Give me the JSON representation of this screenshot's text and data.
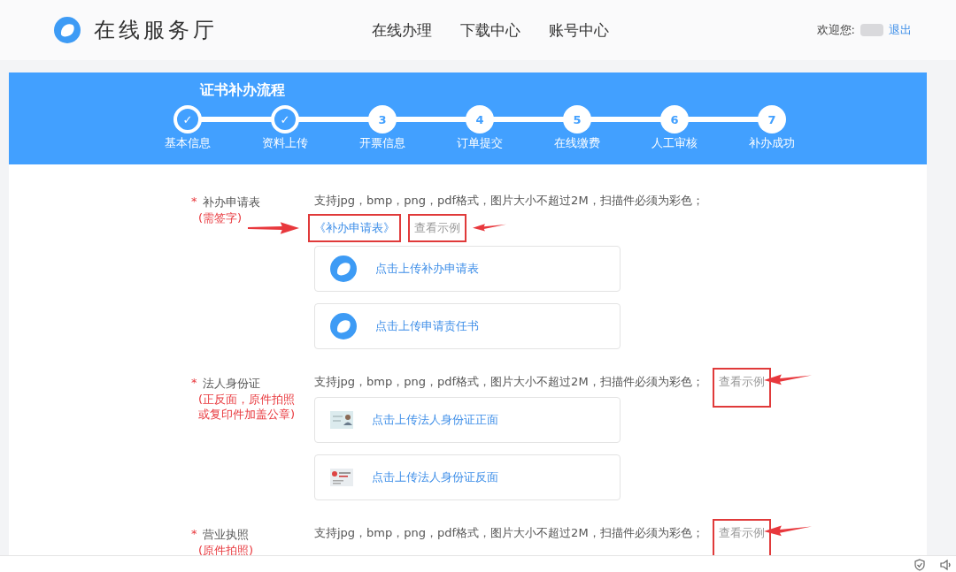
{
  "header": {
    "site_title": "在线服务厅",
    "nav": [
      {
        "label": "在线办理"
      },
      {
        "label": "下载中心"
      },
      {
        "label": "账号中心"
      }
    ],
    "welcome": "欢迎您:",
    "logout": "退出"
  },
  "process": {
    "title": "证书补办流程",
    "steps": [
      {
        "label": "基本信息",
        "done": true
      },
      {
        "label": "资料上传",
        "done": true
      },
      {
        "number": "3",
        "label": "开票信息",
        "done": false
      },
      {
        "number": "4",
        "label": "订单提交",
        "done": false
      },
      {
        "number": "5",
        "label": "在线缴费",
        "done": false
      },
      {
        "number": "6",
        "label": "人工审核",
        "done": false
      },
      {
        "number": "7",
        "label": "补办成功",
        "done": false
      }
    ],
    "check": "✓"
  },
  "sections": [
    {
      "required": "*",
      "label": "补办申请表",
      "note": "(需签字)",
      "hint": "支持jpg，bmp，png，pdf格式，图片大小不超过2M，扫描件必须为彩色；",
      "form_link": {
        "text": "《补办申请表》",
        "marked": true
      },
      "example": {
        "text": "查看示例",
        "marked": true
      },
      "arrow_left": true,
      "arrow_right": true,
      "uploads": [
        {
          "text": "点击上传补办申请表",
          "kind": "logo"
        },
        {
          "text": "点击上传申请责任书",
          "kind": "logo"
        }
      ]
    },
    {
      "required": "*",
      "label": "法人身份证",
      "note": "(正反面，原件拍照或复印件加盖公章)",
      "hint": "支持jpg，bmp，png，pdf格式，图片大小不超过2M，扫描件必须为彩色；",
      "example": {
        "text": "查看示例",
        "marked": true
      },
      "arrow_left": false,
      "arrow_right": true,
      "uploads": [
        {
          "text": "点击上传法人身份证正面",
          "kind": "id_front"
        },
        {
          "text": "点击上传法人身份证反面",
          "kind": "id_back"
        }
      ]
    },
    {
      "required": "*",
      "label": "营业执照",
      "note": "(原件拍照)",
      "hint": "支持jpg，bmp，png，pdf格式，图片大小不超过2M，扫描件必须为彩色；",
      "example": {
        "text": "查看示例",
        "marked": true
      },
      "arrow_left": false,
      "arrow_right": true
    }
  ]
}
